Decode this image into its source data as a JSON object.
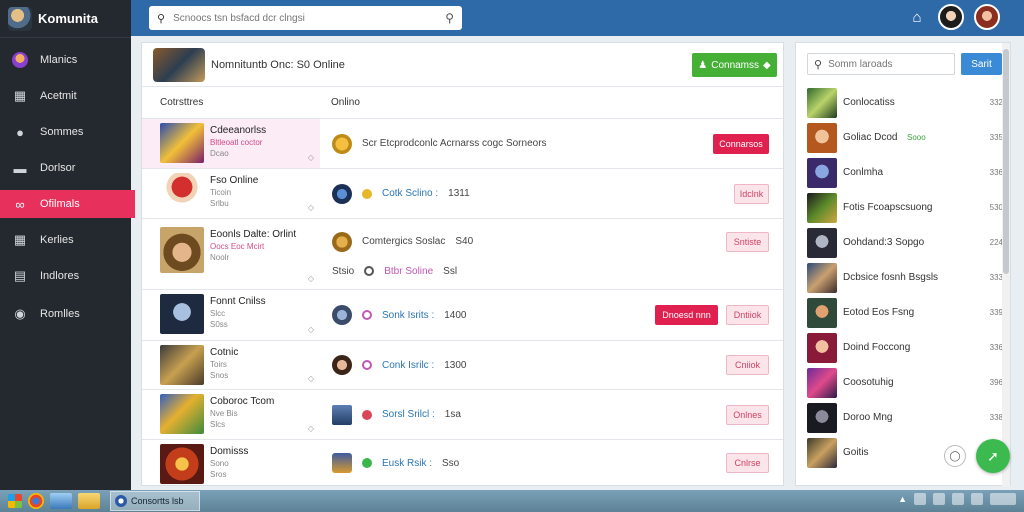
{
  "app": {
    "name": "Komunita"
  },
  "sidebar": {
    "items": [
      {
        "label": "Mlanics",
        "icon": "avatar-icon",
        "active": false
      },
      {
        "label": "Acetmit",
        "icon": "bookmark-icon",
        "active": false
      },
      {
        "label": "Sommes",
        "icon": "chat-bubble-icon",
        "active": false
      },
      {
        "label": "Dorlsor",
        "icon": "controller-icon",
        "active": false
      },
      {
        "label": "Ofilmals",
        "icon": "infinity-icon",
        "active": true
      },
      {
        "label": "Kerlies",
        "icon": "grid-icon",
        "active": false
      },
      {
        "label": "Indlores",
        "icon": "list-icon",
        "active": false
      },
      {
        "label": "Romlles",
        "icon": "globe-icon",
        "active": false
      }
    ]
  },
  "topbar": {
    "search_placeholder": "Scnoocs tsn bsfacd dcr clngsi"
  },
  "main": {
    "header_title": "Nomnituntb Onc: S0 Online",
    "green_button": "Connamss",
    "col_left": "Cotrsttres",
    "col_right": "Onlino",
    "rows": [
      {
        "title": "Cdeeanorlss",
        "sub1": "Bltleoatl coctor",
        "sub2": "Dcao",
        "line1_text": "Scr Etcprodconlc Acrnarss cogc Sorneors",
        "line1_num": "",
        "line2_text": "",
        "line2_num": "",
        "btn_red": "Connarsos",
        "btn_pink": ""
      },
      {
        "title": "Fso Online",
        "sub1": "Ticoin",
        "sub2": "Srlbu",
        "line1_text": "Cotk Sclino :",
        "line1_num": "1311",
        "line2_text": "",
        "line2_num": "",
        "btn_red": "",
        "btn_pink": "Idclnk"
      },
      {
        "title": "Eoonls Dalte: Orlint",
        "sub1": "Oocs Eoc Mcirt",
        "sub2": "Noolr",
        "line1_text": "Comtergics Soslac",
        "line1_num": "S40",
        "line2_text": "Btbr Soline",
        "line2_num": "Ssl",
        "line2_prefix": "Stsio",
        "btn_red": "",
        "btn_pink": "Sntiste"
      },
      {
        "title": "Fonnt Cnilss",
        "sub1": "Slcc",
        "sub2": "S0ss",
        "line1_text": "Sonk Isrits :",
        "line1_num": "1400",
        "line2_text": "",
        "line2_num": "",
        "btn_red": "Dnoesd nnn",
        "btn_pink": "Dntiiok"
      },
      {
        "title": "Cotnic",
        "sub1": "Toirs",
        "sub2": "Snos",
        "line1_text": "Conk Isrilc :",
        "line1_num": "1300",
        "line2_text": "",
        "line2_num": "",
        "btn_red": "",
        "btn_pink": "Cniiok"
      },
      {
        "title": "Coboroc Tcom",
        "sub1": "Nve Bis",
        "sub2": "Slcs",
        "line1_text": "Sorsl Srilcl :",
        "line1_num": "1sa",
        "line2_text": "",
        "line2_num": "",
        "btn_red": "",
        "btn_pink": "Onlnes"
      },
      {
        "title": "Domisss",
        "sub1": "Sono",
        "sub2": "Sros",
        "line1_text": "Eusk Rsik :",
        "line1_num": "Sso",
        "line2_text": "",
        "line2_num": "",
        "btn_red": "",
        "btn_pink": "Cnlrse"
      }
    ]
  },
  "right": {
    "search_placeholder": "Somm laroads",
    "button": "Sarit",
    "items": [
      {
        "name": "Conlocatiss",
        "num": "332"
      },
      {
        "name": "Goliac Dcod",
        "num": "335"
      },
      {
        "name": "Conlmha",
        "num": "336"
      },
      {
        "name": "Fotis Fcoapscsuong",
        "num": "530"
      },
      {
        "name": "Oohdand:3 Sopgo",
        "num": "224"
      },
      {
        "name": "Dcbsice fosnh Bsgsls",
        "num": "333"
      },
      {
        "name": "Eotod Eos Fsng",
        "num": "339"
      },
      {
        "name": "Doind Foccong",
        "num": "336"
      },
      {
        "name": "Coosotuhig",
        "num": "396"
      },
      {
        "name": "Doroo Mng",
        "num": "338"
      },
      {
        "name": "Goitis",
        "num": ""
      }
    ],
    "green_tag": "Sooo"
  },
  "taskbar": {
    "task_label": "Consortts lsb"
  }
}
